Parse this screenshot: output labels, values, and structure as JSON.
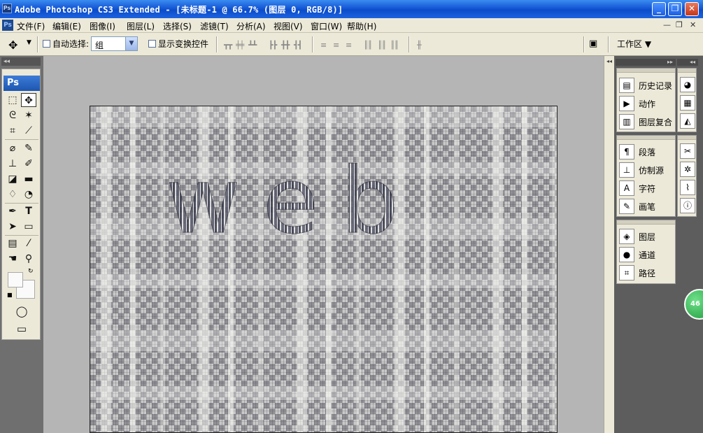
{
  "window": {
    "app_icon": "Ps",
    "title": "Adobe Photoshop CS3 Extended - [未标题-1 @ 66.7% (图层 0, RGB/8)]",
    "buttons": [
      "_",
      "❐",
      "✕"
    ]
  },
  "menubar": {
    "logo": "Ps",
    "items": [
      "文件(F)",
      "编辑(E)",
      "图像(I)",
      "图层(L)",
      "选择(S)",
      "滤镜(T)",
      "分析(A)",
      "视图(V)",
      "窗口(W)",
      "帮助(H)"
    ],
    "doc_controls": [
      "—",
      "❐",
      "✕"
    ]
  },
  "options": {
    "auto_select_label": "自动选择:",
    "auto_select_value": "组",
    "show_transform_label": "显示变换控件",
    "workspace_label": "工作区 ▼"
  },
  "tools": {
    "logo": "Ps",
    "collapse": "◂◂",
    "items": [
      {
        "icon": "marquee-icon",
        "glyph": "⬚"
      },
      {
        "icon": "move-icon",
        "glyph": "✥"
      },
      {
        "icon": "lasso-icon",
        "glyph": "ᘓ"
      },
      {
        "icon": "magic-wand-icon",
        "glyph": "✶"
      },
      {
        "icon": "crop-icon",
        "glyph": "⌗"
      },
      {
        "icon": "slice-icon",
        "glyph": "⟋"
      },
      {
        "icon": "healing-brush-icon",
        "glyph": "⌀"
      },
      {
        "icon": "brush-icon",
        "glyph": "✎"
      },
      {
        "icon": "clone-stamp-icon",
        "glyph": "⊥"
      },
      {
        "icon": "history-brush-icon",
        "glyph": "✐"
      },
      {
        "icon": "eraser-icon",
        "glyph": "◪"
      },
      {
        "icon": "gradient-icon",
        "glyph": "▬"
      },
      {
        "icon": "blur-icon",
        "glyph": "♢"
      },
      {
        "icon": "dodge-icon",
        "glyph": "◔"
      },
      {
        "icon": "pen-icon",
        "glyph": "✒"
      },
      {
        "icon": "type-icon",
        "glyph": "T"
      },
      {
        "icon": "path-selection-icon",
        "glyph": "➤"
      },
      {
        "icon": "shape-icon",
        "glyph": "▭"
      },
      {
        "icon": "notes-icon",
        "glyph": "▤"
      },
      {
        "icon": "eyedropper-icon",
        "glyph": "⁄"
      },
      {
        "icon": "hand-icon",
        "glyph": "☚"
      },
      {
        "icon": "zoom-icon",
        "glyph": "⚲"
      }
    ],
    "quick_mask": "◯",
    "screen_mode": "▭"
  },
  "panels": {
    "group1": [
      "历史记录",
      "动作",
      "图层复合"
    ],
    "group2": [
      "段落",
      "仿制源",
      "字符",
      "画笔"
    ],
    "group3": [
      "图层",
      "通道",
      "路径"
    ]
  },
  "canvas": {
    "text": "web"
  },
  "badge": "46"
}
